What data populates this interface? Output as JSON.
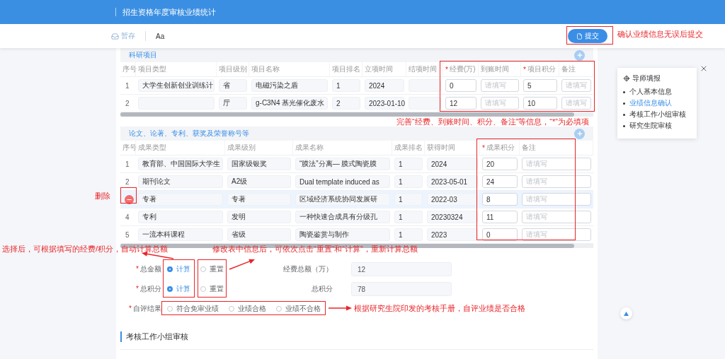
{
  "header": {
    "title": "招生资格年度审核业绩统计"
  },
  "toolbar": {
    "save": "暂存",
    "font": "Aa",
    "submit": "提交"
  },
  "research": {
    "title": "科研项目",
    "columns": [
      {
        "label": "序号"
      },
      {
        "label": "项目类型"
      },
      {
        "label": "项目级别"
      },
      {
        "label": "项目名称"
      },
      {
        "label": "项目排名"
      },
      {
        "label": "立项时间"
      },
      {
        "label": "结项时间"
      },
      {
        "label": "经费(万)",
        "required_mark": "*"
      },
      {
        "label": "到账时间"
      },
      {
        "label": "项目积分",
        "required_mark": "*"
      },
      {
        "label": "备注"
      }
    ],
    "rows": [
      {
        "selected": false,
        "cells": [
          {
            "kind": "plain",
            "value": "1"
          },
          {
            "kind": "readonly",
            "value": "大学生创新创业训练计"
          },
          {
            "kind": "readonly",
            "value": "省"
          },
          {
            "kind": "readonly",
            "value": "电磁污染之盾"
          },
          {
            "kind": "readonly",
            "value": "1"
          },
          {
            "kind": "readonly",
            "value": "2024"
          },
          {
            "kind": "readonly"
          },
          {
            "kind": "input",
            "value": "0"
          },
          {
            "kind": "input",
            "placeholder": "请填写"
          },
          {
            "kind": "input",
            "value": "5"
          },
          {
            "kind": "input",
            "placeholder": "请填写"
          }
        ]
      },
      {
        "selected": false,
        "cells": [
          {
            "kind": "plain",
            "value": "2"
          },
          {
            "kind": "readonly"
          },
          {
            "kind": "readonly",
            "value": "厅"
          },
          {
            "kind": "readonly",
            "value": "g-C3N4 基光催化废水"
          },
          {
            "kind": "readonly",
            "value": "2"
          },
          {
            "kind": "readonly",
            "value": "2023-01-10"
          },
          {
            "kind": "readonly"
          },
          {
            "kind": "input",
            "value": "12"
          },
          {
            "kind": "input",
            "placeholder": "请填写"
          },
          {
            "kind": "input",
            "value": "10"
          },
          {
            "kind": "input",
            "placeholder": "请填写"
          }
        ]
      }
    ]
  },
  "achievements": {
    "title": "论文、论著、专利、获奖及荣誉称号等",
    "columns": [
      {
        "label": "序号"
      },
      {
        "label": "成果类型"
      },
      {
        "label": "成果级别"
      },
      {
        "label": "成果名称"
      },
      {
        "label": "成果排名"
      },
      {
        "label": "获得时间"
      },
      {
        "label": "成果积分",
        "required_mark": "*"
      },
      {
        "label": "备注"
      }
    ],
    "rows": [
      {
        "selected": false,
        "cells": [
          {
            "kind": "plain",
            "value": "1"
          },
          {
            "kind": "readonly",
            "value": "教育部、中国国际大学生"
          },
          {
            "kind": "readonly",
            "value": "国家级银奖"
          },
          {
            "kind": "readonly",
            "value": "“膜法”分离— 膜式陶瓷膜"
          },
          {
            "kind": "readonly",
            "value": "1"
          },
          {
            "kind": "readonly",
            "value": "2024"
          },
          {
            "kind": "input",
            "value": "20"
          },
          {
            "kind": "input",
            "placeholder": "请填写"
          }
        ]
      },
      {
        "selected": false,
        "cells": [
          {
            "kind": "plain",
            "value": "2"
          },
          {
            "kind": "readonly",
            "value": "期刊论文"
          },
          {
            "kind": "readonly",
            "value": "A2级"
          },
          {
            "kind": "readonly",
            "value": "Dual template induced as"
          },
          {
            "kind": "readonly",
            "value": "1"
          },
          {
            "kind": "readonly",
            "value": "2023-05-01"
          },
          {
            "kind": "input",
            "value": "24"
          },
          {
            "kind": "input",
            "placeholder": "请填写"
          }
        ]
      },
      {
        "selected": true,
        "cells": [
          {
            "kind": "delete"
          },
          {
            "kind": "readonly",
            "value": "专著"
          },
          {
            "kind": "readonly",
            "value": "专著"
          },
          {
            "kind": "readonly",
            "value": "区域经济系统协同发展研"
          },
          {
            "kind": "readonly",
            "value": "1"
          },
          {
            "kind": "readonly",
            "value": "2022-03"
          },
          {
            "kind": "input",
            "value": "8"
          },
          {
            "kind": "input",
            "placeholder": "请填写"
          }
        ]
      },
      {
        "selected": false,
        "cells": [
          {
            "kind": "plain",
            "value": "4"
          },
          {
            "kind": "readonly",
            "value": "专利"
          },
          {
            "kind": "readonly",
            "value": "发明"
          },
          {
            "kind": "readonly",
            "value": "一种快速合成具有分级孔"
          },
          {
            "kind": "readonly",
            "value": "1"
          },
          {
            "kind": "readonly",
            "value": "20230324"
          },
          {
            "kind": "input",
            "value": "11"
          },
          {
            "kind": "input",
            "placeholder": "请填写"
          }
        ]
      },
      {
        "selected": false,
        "cells": [
          {
            "kind": "plain",
            "value": "5"
          },
          {
            "kind": "readonly",
            "value": "一流本科课程"
          },
          {
            "kind": "readonly",
            "value": "省级"
          },
          {
            "kind": "readonly",
            "value": "陶瓷鉴赏与制作"
          },
          {
            "kind": "readonly",
            "value": "1"
          },
          {
            "kind": "readonly",
            "value": "2023"
          },
          {
            "kind": "input",
            "value": "0"
          },
          {
            "kind": "input",
            "placeholder": "请填写"
          }
        ]
      }
    ]
  },
  "totals": [
    {
      "label": "总金额",
      "required_mark": "*",
      "options": [
        {
          "label": "计算",
          "selected": true
        },
        {
          "label": "重置",
          "selected": false
        }
      ],
      "field_label": "经费总额（万）",
      "value": "12"
    },
    {
      "label": "总积分",
      "required_mark": "*",
      "options": [
        {
          "label": "计算",
          "selected": true
        },
        {
          "label": "重置",
          "selected": false
        }
      ],
      "field_label": "总积分",
      "value": "78"
    }
  ],
  "self_eval": {
    "label": "自评结果",
    "required_mark": "*",
    "options": [
      {
        "label": "符合免审业绩",
        "selected": false
      },
      {
        "label": "业绩合格",
        "selected": false
      },
      {
        "label": "业绩不合格",
        "selected": false
      }
    ]
  },
  "review": {
    "title": "考核工作小组审核"
  },
  "guide": {
    "title": "导师填报",
    "items": [
      {
        "label": "个人基本信息",
        "selected": false
      },
      {
        "label": "业绩信息确认",
        "selected": true
      },
      {
        "label": "考核工作小组审核",
        "selected": false
      },
      {
        "label": "研究生院审核",
        "selected": false
      }
    ]
  },
  "annotations": [
    {
      "text": "确认业绩信息无误后提交"
    },
    {
      "text": "完善“经费、到账时间、积分、备注”等信息，“*”为必填项"
    },
    {
      "text": "删除"
    },
    {
      "text": "选择后，可根据填写的经费/积分，自动计算总额"
    },
    {
      "text": "修改表中信息后，可依次点击“重置”和“计算”，重新计算总额"
    },
    {
      "text": "根据研究生院印发的考核手册，自评业绩是否合格"
    }
  ]
}
